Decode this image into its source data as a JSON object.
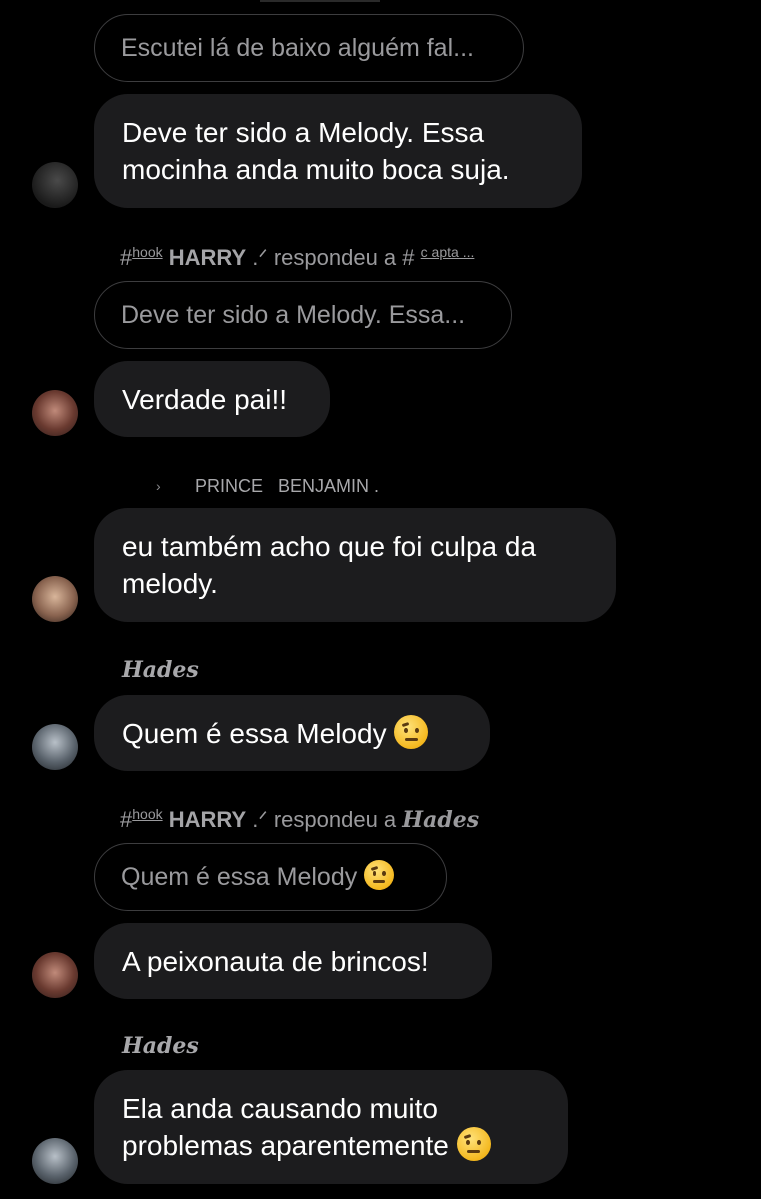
{
  "messages": {
    "quote1": "Escutei lá de baixo alguém fal...",
    "msg1_line1": "Deve ter sido a Melody. Essa",
    "msg1_line2": "mocinha anda muito boca suja.",
    "reply1": {
      "hash": "#",
      "prefix": "hook",
      "name": "HARRY",
      "suffix": ".ᐟ",
      "verb": "respondeu a",
      "target_hash": "#",
      "target": "c apta ..."
    },
    "quote2": "Deve ter sido a Melody. Essa...",
    "msg2": "Verdade pai!!",
    "sender3_chevron": "›",
    "sender3": "PRINCE   BENJAMIN .",
    "msg3_line1": "eu também acho que foi culpa da",
    "msg3_line2": "melody.",
    "sender4": "Hades",
    "msg4": "Quem é essa Melody",
    "reply2": {
      "hash": "#",
      "prefix": "hook",
      "name": "HARRY",
      "suffix": ".ᐟ",
      "verb": "respondeu a",
      "target": "Hades"
    },
    "quote3": "Quem é essa Melody",
    "msg5": "A peixonauta de brincos!",
    "sender6": "Hades",
    "msg6_line1": "Ela anda causando muito",
    "msg6_line2": "problemas aparentemente"
  },
  "emoji": "face-with-raised-eyebrow"
}
